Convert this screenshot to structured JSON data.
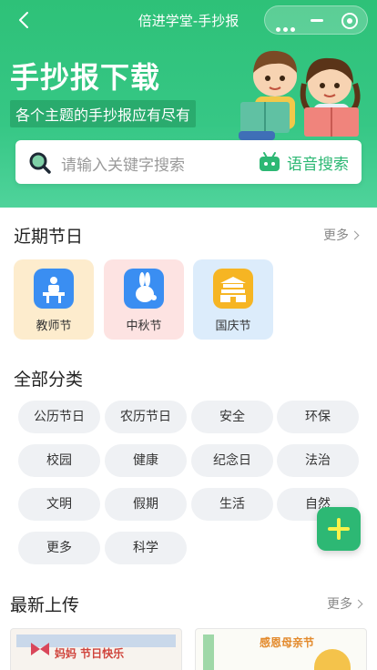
{
  "nav": {
    "title": "倍进学堂-手抄报"
  },
  "hero": {
    "title": "手抄报下载",
    "subtitle": "各个主题的手抄报应有尽有"
  },
  "search": {
    "placeholder": "请输入关键字搜索",
    "voice_label": "语音搜索"
  },
  "recent": {
    "title": "近期节日",
    "more": "更多",
    "items": [
      {
        "label": "教师节",
        "icon": "teacher-icon",
        "bg": "#fdeccd",
        "icon_bg": "#3a8ef2"
      },
      {
        "label": "中秋节",
        "icon": "rabbit-icon",
        "bg": "#fde3e2",
        "icon_bg": "#3a8ef2"
      },
      {
        "label": "国庆节",
        "icon": "gate-icon",
        "bg": "#dcecfb",
        "icon_bg": "#f6b523"
      }
    ]
  },
  "categories": {
    "title": "全部分类",
    "items": [
      "公历节日",
      "农历节日",
      "安全",
      "环保",
      "校园",
      "健康",
      "纪念日",
      "法治",
      "文明",
      "假期",
      "生活",
      "自然",
      "更多",
      "科学"
    ]
  },
  "latest": {
    "title": "最新上传",
    "more": "更多",
    "cards": [
      {
        "text": "妈妈  节日快乐"
      },
      {
        "text": "感恩母亲节"
      }
    ]
  },
  "colors": {
    "brand": "#2db874",
    "header_start": "#2ec178",
    "fab_plus": "#f8f24a"
  }
}
